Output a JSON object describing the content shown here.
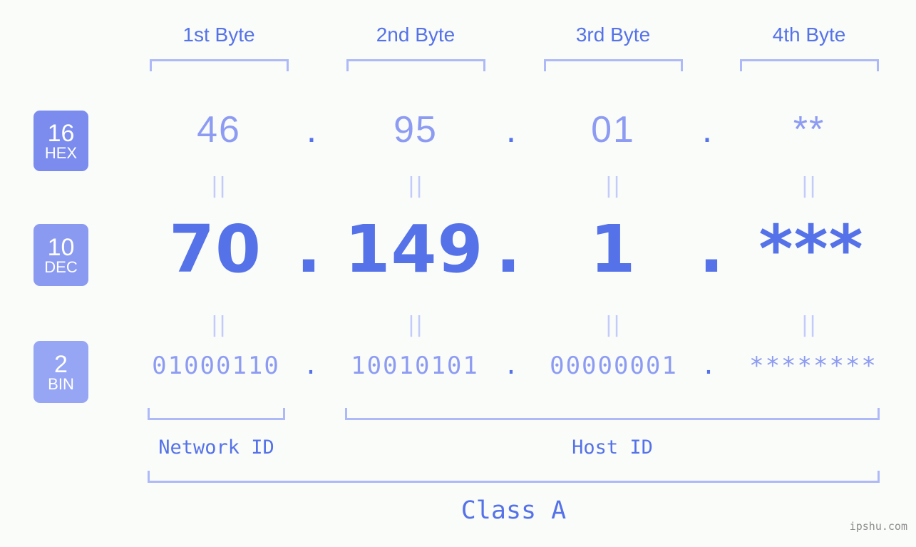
{
  "background_color": "#fafcfa",
  "accent_color": "#5572e8",
  "accent_light_color": "#8d9cf2",
  "bracket_color": "#aeb9f7",
  "byte_headers": [
    {
      "label": "1st Byte"
    },
    {
      "label": "2nd Byte"
    },
    {
      "label": "3rd Byte"
    },
    {
      "label": "4th Byte"
    }
  ],
  "radix_badges": [
    {
      "base": "16",
      "name": "HEX",
      "color": "#7b8cee"
    },
    {
      "base": "10",
      "name": "DEC",
      "color": "#8b9af1"
    },
    {
      "base": "2",
      "name": "BIN",
      "color": "#96a6f4"
    }
  ],
  "rows": {
    "hex": {
      "values": [
        "46",
        "95",
        "01",
        "**"
      ],
      "separator": "."
    },
    "dec": {
      "values": [
        "70",
        "149",
        "1",
        "***"
      ],
      "separator": "."
    },
    "bin": {
      "values": [
        "01000110",
        "10010101",
        "00000001",
        "********"
      ],
      "separator": "."
    }
  },
  "equals_glyph": "||",
  "sections": {
    "network_id": "Network ID",
    "host_id": "Host ID",
    "class": "Class A"
  },
  "watermark": "ipshu.com"
}
